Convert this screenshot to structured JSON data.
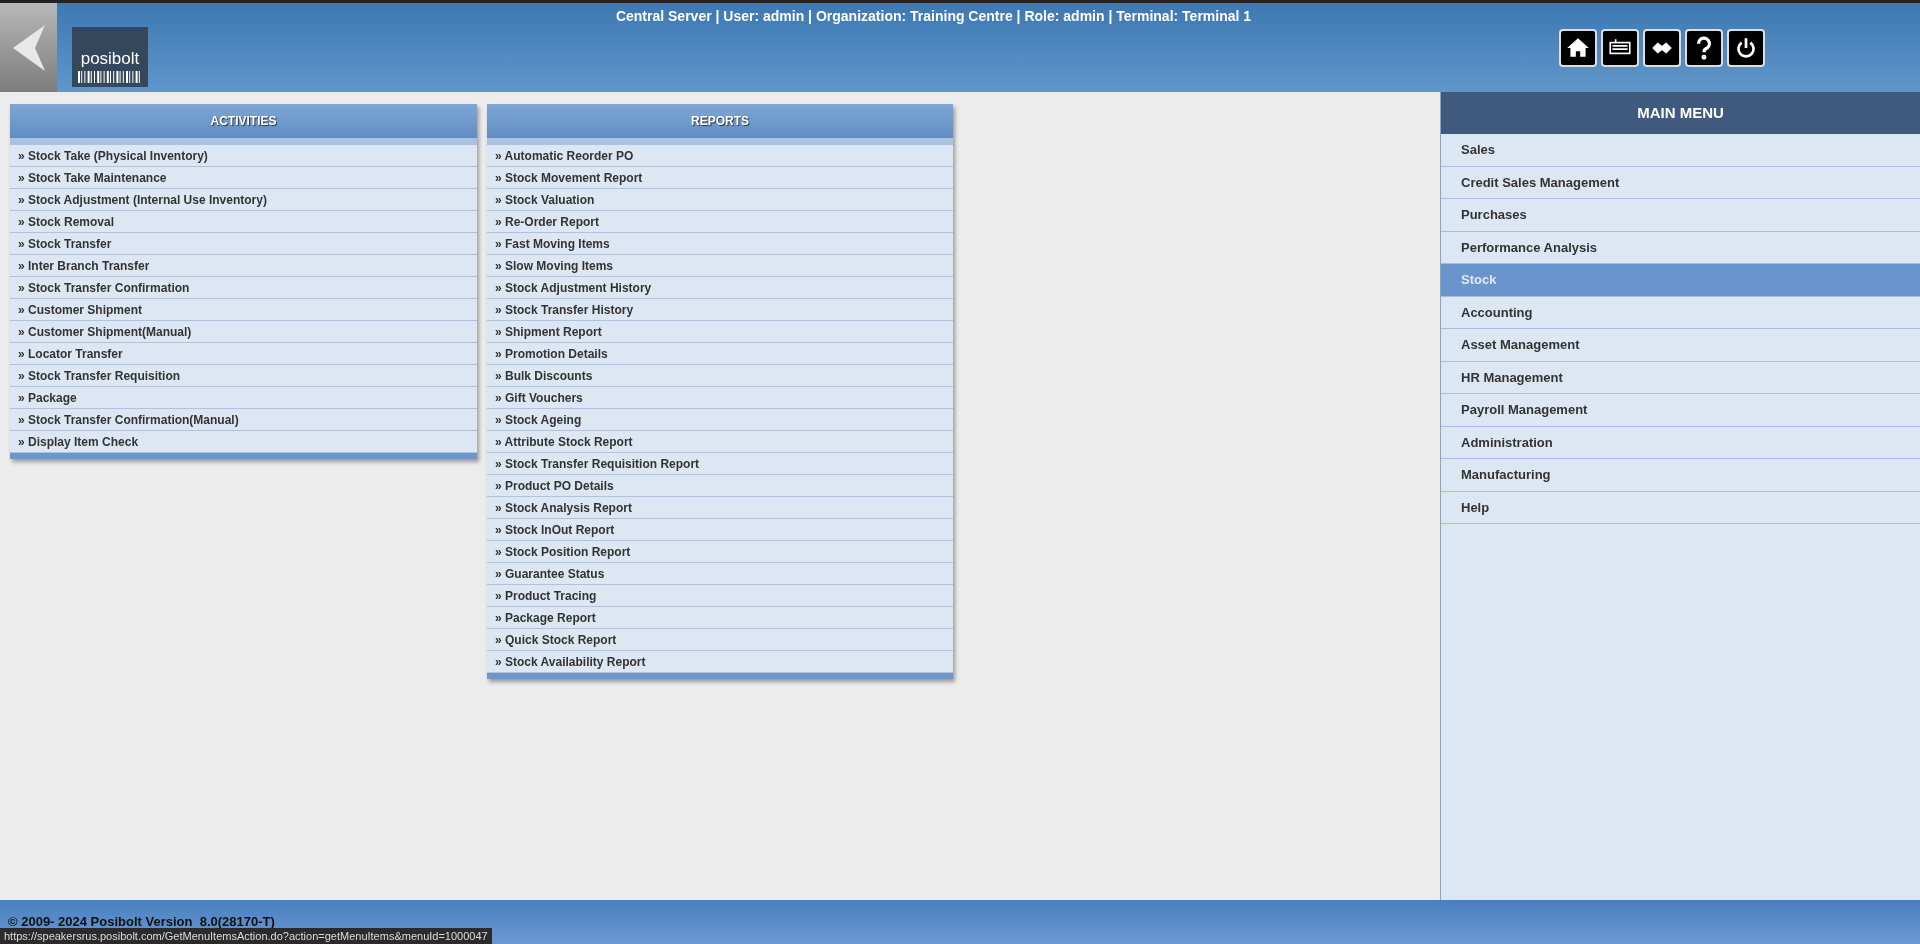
{
  "header": {
    "logo_text": "posibolt",
    "session_info": "Central Server | User: admin | Organization: Training Centre | Role: admin | Terminal: Terminal 1"
  },
  "activities": {
    "title": "ACTIVITIES",
    "items": [
      "» Stock Take (Physical Inventory)",
      "» Stock Take Maintenance",
      "» Stock Adjustment (Internal Use Inventory)",
      "» Stock Removal",
      "» Stock Transfer",
      "» Inter Branch Transfer",
      "» Stock Transfer Confirmation",
      "» Customer Shipment",
      "» Customer Shipment(Manual)",
      "» Locator Transfer",
      "» Stock Transfer Requisition",
      "» Package",
      "» Stock Transfer Confirmation(Manual)",
      "» Display Item Check"
    ]
  },
  "reports": {
    "title": "REPORTS",
    "items": [
      "» Automatic Reorder PO",
      "» Stock Movement Report",
      "» Stock Valuation",
      "» Re-Order Report",
      "» Fast Moving Items",
      "» Slow Moving Items",
      "» Stock Adjustment History",
      "» Stock Transfer History",
      "» Shipment Report",
      "» Promotion Details",
      "» Bulk Discounts",
      "» Gift Vouchers",
      "» Stock Ageing",
      "» Attribute Stock Report",
      "» Stock Transfer Requisition Report",
      "» Product PO Details",
      "» Stock Analysis Report",
      "» Stock InOut Report",
      "» Stock Position Report",
      "» Guarantee Status",
      "» Product Tracing",
      "» Package Report",
      "» Quick Stock Report",
      "» Stock Availability Report"
    ]
  },
  "main_menu": {
    "title": "MAIN MENU",
    "items": [
      {
        "label": "Sales",
        "selected": false
      },
      {
        "label": "Credit Sales Management",
        "selected": false
      },
      {
        "label": "Purchases",
        "selected": false
      },
      {
        "label": "Performance Analysis",
        "selected": false
      },
      {
        "label": "Stock",
        "selected": true
      },
      {
        "label": "Accounting",
        "selected": false
      },
      {
        "label": "Asset Management",
        "selected": false
      },
      {
        "label": "HR Management",
        "selected": false
      },
      {
        "label": "Payroll Management",
        "selected": false
      },
      {
        "label": "Administration",
        "selected": false
      },
      {
        "label": "Manufacturing",
        "selected": false
      },
      {
        "label": "Help",
        "selected": false
      }
    ]
  },
  "footer": {
    "copyright": "© 2009- 2024 Posibolt Version  8.0(28170-T)"
  },
  "status_url": "https://speakersrus.posibolt.com/GetMenuItemsAction.do?action=getMenuItems&menuId=1000047"
}
